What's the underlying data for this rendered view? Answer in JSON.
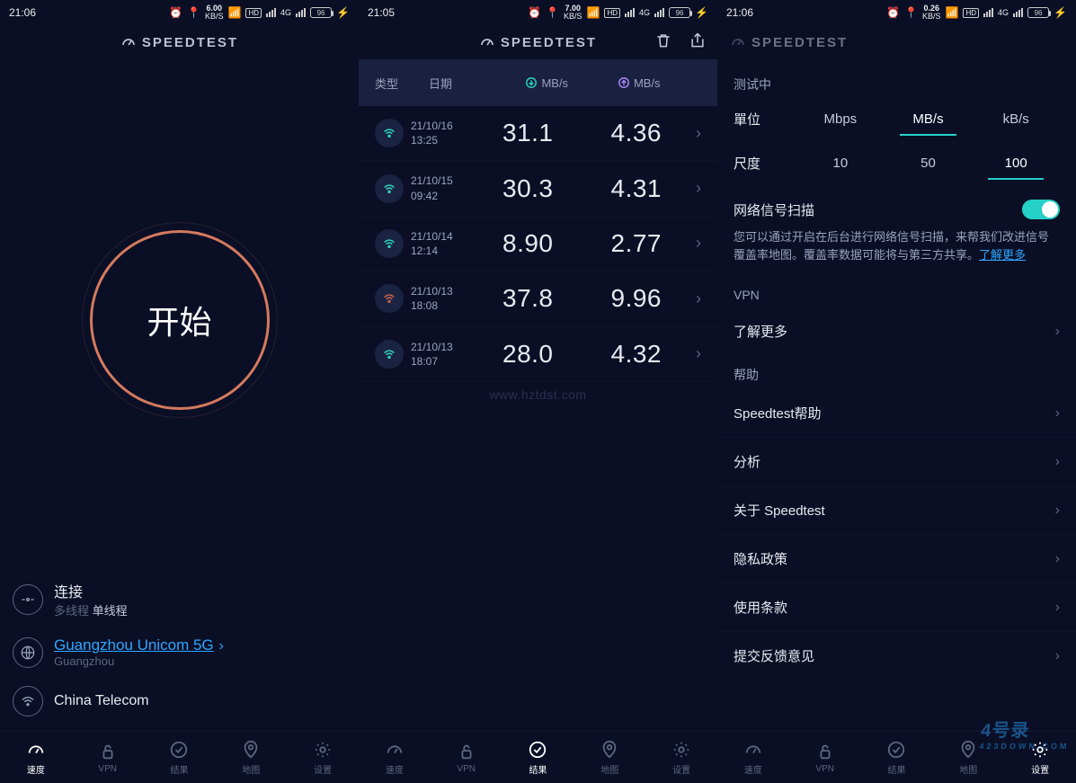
{
  "status": [
    {
      "time": "21:06",
      "kbs": "6.00",
      "bat": "96"
    },
    {
      "time": "21:05",
      "kbs": "7.00",
      "bat": "96"
    },
    {
      "time": "21:06",
      "kbs": "0.26",
      "bat": "96"
    }
  ],
  "app_title": "SPEEDTEST",
  "pane1": {
    "go": "开始",
    "connection": {
      "label": "连接",
      "multi": "多线程",
      "mode": "单线程"
    },
    "server": {
      "name": "Guangzhou Unicom 5G",
      "city": "Guangzhou"
    },
    "carrier": "China Telecom"
  },
  "pane2": {
    "header": {
      "type": "类型",
      "date": "日期",
      "download": "MB/s",
      "upload": "MB/s"
    },
    "rows": [
      {
        "date": "21/10/16",
        "time": "13:25",
        "down": "31.1",
        "up": "4.36",
        "low": false
      },
      {
        "date": "21/10/15",
        "time": "09:42",
        "down": "30.3",
        "up": "4.31",
        "low": false
      },
      {
        "date": "21/10/14",
        "time": "12:14",
        "down": "8.90",
        "up": "2.77",
        "low": false
      },
      {
        "date": "21/10/13",
        "time": "18:08",
        "down": "37.8",
        "up": "9.96",
        "low": true
      },
      {
        "date": "21/10/13",
        "time": "18:07",
        "down": "28.0",
        "up": "4.32",
        "low": false
      }
    ],
    "watermark": "www.hztdst.com"
  },
  "pane3": {
    "testing": "测试中",
    "unit": {
      "label": "單位",
      "opts": [
        "Mbps",
        "MB/s",
        "kB/s"
      ],
      "active": 1
    },
    "scale": {
      "label": "尺度",
      "opts": [
        "10",
        "50",
        "100"
      ],
      "active": 2
    },
    "scan": {
      "label": "网络信号扫描",
      "desc_pre": "您可以通过开启在后台进行网络信号扫描，来帮我们改进信号覆盖率地图。覆盖率数据可能将与第三方共享。",
      "learn": "了解更多"
    },
    "vpn": {
      "label": "VPN",
      "more": "了解更多"
    },
    "help": {
      "label": "帮助",
      "items": [
        "Speedtest帮助",
        "分析",
        "关于 Speedtest",
        "隐私政策",
        "使用条款",
        "提交反馈意见"
      ]
    }
  },
  "tabs": [
    "速度",
    "VPN",
    "结果",
    "地图",
    "设置"
  ],
  "tab_active": {
    "p1": 0,
    "p2": 2,
    "p3": 4
  },
  "site_wm": {
    "main": "4号录",
    "sub": "423DOWN.COM"
  }
}
